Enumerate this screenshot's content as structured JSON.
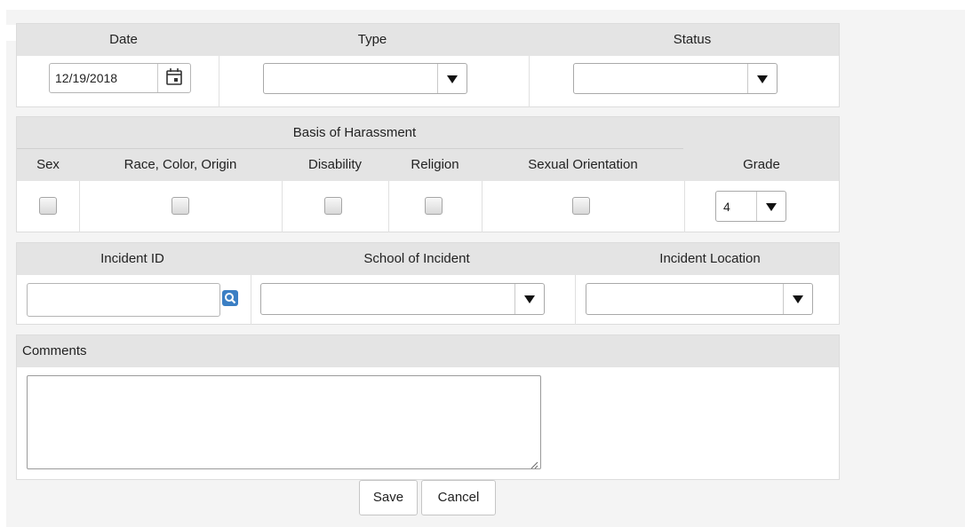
{
  "row1": {
    "date_label": "Date",
    "type_label": "Type",
    "status_label": "Status",
    "date_value": "12/19/2018",
    "type_value": "",
    "status_value": ""
  },
  "harassment": {
    "group_label": "Basis of Harassment",
    "columns": [
      "Sex",
      "Race, Color, Origin",
      "Disability",
      "Religion",
      "Sexual Orientation"
    ],
    "checked": [
      false,
      false,
      false,
      false,
      false
    ],
    "grade_label": "Grade",
    "grade_value": "4"
  },
  "incident": {
    "id_label": "Incident ID",
    "school_label": "School of Incident",
    "location_label": "Incident Location",
    "id_value": "",
    "school_value": "",
    "location_value": ""
  },
  "comments": {
    "label": "Comments",
    "value": ""
  },
  "buttons": {
    "save": "Save",
    "cancel": "Cancel"
  }
}
